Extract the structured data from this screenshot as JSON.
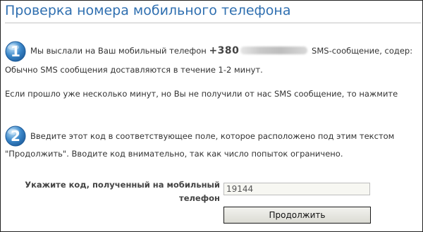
{
  "header": {
    "title": "Проверка номера мобильного телефона"
  },
  "step1": {
    "number": "1",
    "text_before_phone": "Мы выслали на Ваш мобильный телефон ",
    "phone_prefix": "+380",
    "text_after_phone": " SMS-сообщение, содер:",
    "delivery_note": "Обычно SMS сообщения доставляются в течение 1-2 минут.",
    "resend_note": "Если прошло уже несколько минут, но Вы не получили от нас SMS сообщение, то нажмите"
  },
  "step2": {
    "number": "2",
    "line1": "Введите этот код в соответствующее поле, которое расположено под этим текстом",
    "line2": "\"Продолжить\". Вводите код внимательно, так как число попыток ограничено."
  },
  "form": {
    "code_label": "Укажите код, полученный на мобильный телефон",
    "code_value": "19144",
    "submit_label": "Продолжить"
  },
  "colors": {
    "title": "#2f6fb0",
    "step_icon": "#3a86c8"
  }
}
